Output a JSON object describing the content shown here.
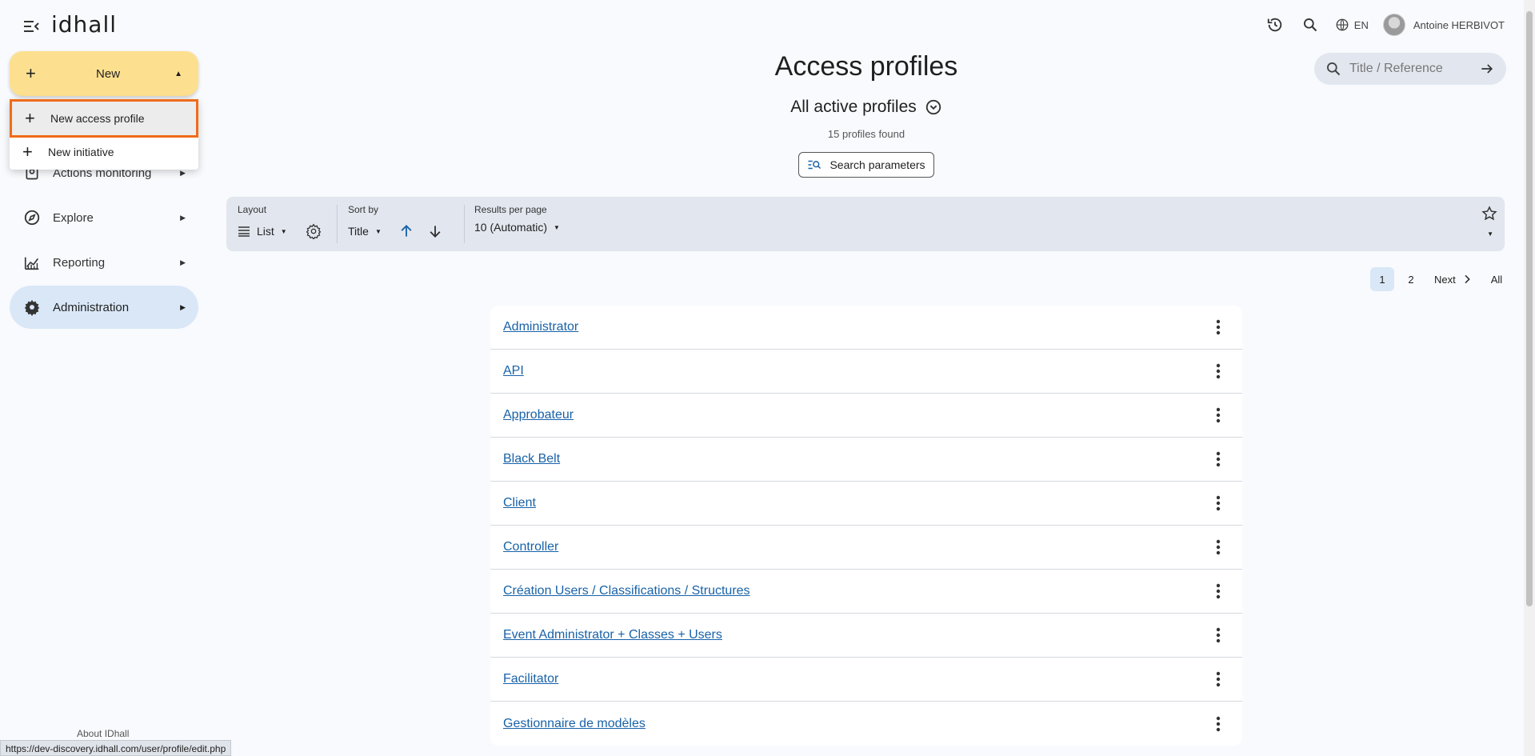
{
  "header": {
    "logo": "idhall",
    "lang": "EN",
    "user_name": "Antoine HERBIVOT"
  },
  "sidebar": {
    "new_label": "New",
    "dropdown": [
      {
        "label": "New access profile"
      },
      {
        "label": "New initiative"
      }
    ],
    "items": [
      {
        "label": "Actions monitoring"
      },
      {
        "label": "Explore"
      },
      {
        "label": "Reporting"
      },
      {
        "label": "Administration"
      }
    ],
    "about": "About IDhall"
  },
  "search": {
    "placeholder": "Title / Reference"
  },
  "main": {
    "title": "Access profiles",
    "subtitle": "All active profiles",
    "count_number": "15",
    "count_text": "profiles found",
    "search_params_label": "Search parameters"
  },
  "toolbar": {
    "layout_label": "Layout",
    "layout_value": "List",
    "sort_label": "Sort by",
    "sort_value": "Title",
    "results_label": "Results per page",
    "results_value": "10 (Automatic)"
  },
  "pagination": {
    "current": "1",
    "page2": "2",
    "next": "Next",
    "all": "All"
  },
  "profiles": [
    "Administrator",
    "API",
    "Approbateur",
    "Black Belt",
    "Client",
    "Controller",
    "Création Users / Classifications / Structures",
    "Event Administrator + Classes + Users",
    "Facilitator",
    "Gestionnaire de modèles"
  ],
  "status_url": "https://dev-discovery.idhall.com/user/profile/edit.php",
  "colors": {
    "new_button": "#fde08f",
    "active_nav": "#d9e7f7",
    "highlight_border": "#f06c1a",
    "link": "#1862a8"
  }
}
